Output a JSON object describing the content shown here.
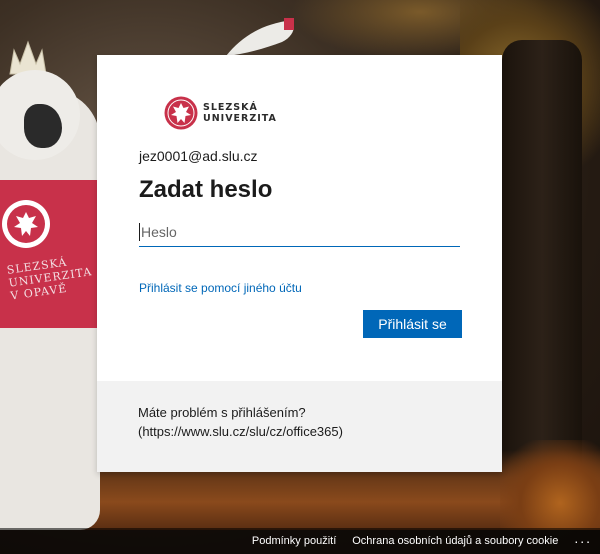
{
  "brand": {
    "logo_line1": "SLEZSKÁ",
    "logo_line2": "UNIVERZITA",
    "color": "#c8314a"
  },
  "background": {
    "mascot_text_line1": "SLEZSKÁ",
    "mascot_text_line2": "UNIVERZITA",
    "mascot_text_line3": "V OPAVĚ"
  },
  "login": {
    "identity": "jez0001@ad.slu.cz",
    "title": "Zadat heslo",
    "password_placeholder": "Heslo",
    "password_value": "",
    "alt_account_link": "Přihlásit se pomocí jiného účtu",
    "submit_label": "Přihlásit se",
    "accent_color": "#0067b8"
  },
  "help": {
    "line1": "Máte problém s přihlášením?",
    "line2": "(https://www.slu.cz/slu/cz/office365)"
  },
  "footer": {
    "terms": "Podmínky použití",
    "privacy": "Ochrana osobních údajů a soubory cookie",
    "more": "..."
  }
}
